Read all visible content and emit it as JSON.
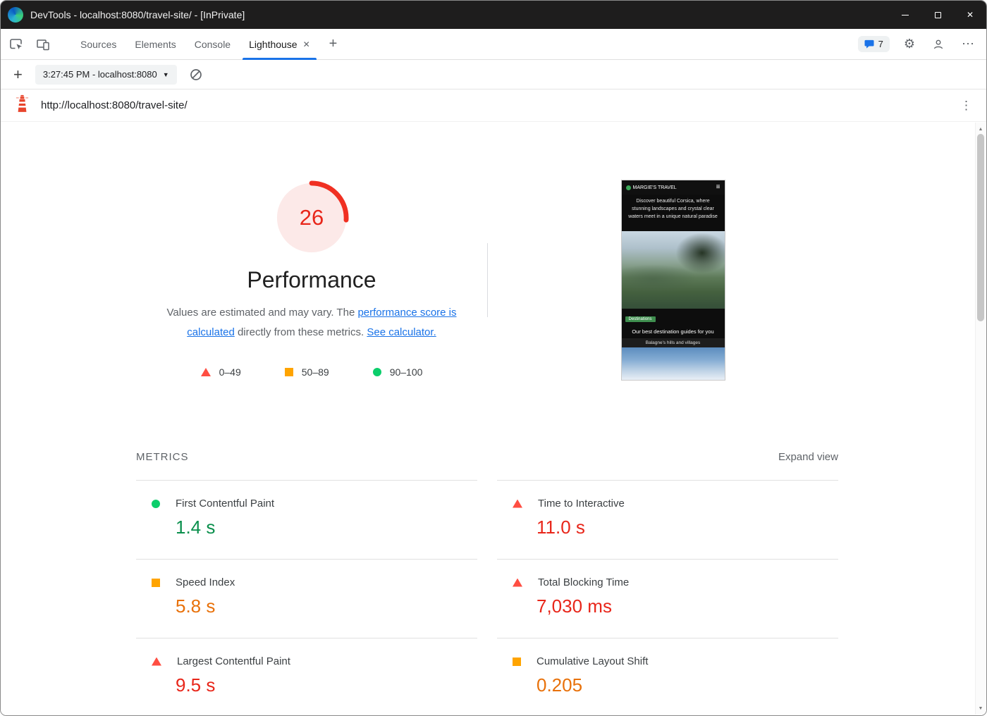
{
  "window": {
    "title": "DevTools - localhost:8080/travel-site/ - [InPrivate]"
  },
  "devtools": {
    "tabs": [
      {
        "label": "Sources"
      },
      {
        "label": "Elements"
      },
      {
        "label": "Console"
      },
      {
        "label": "Lighthouse"
      }
    ],
    "active_tab": "Lighthouse",
    "issues_count": "7"
  },
  "lighthouse_toolbar": {
    "report_selector": "3:27:45 PM - localhost:8080"
  },
  "url_bar": {
    "url": "http://localhost:8080/travel-site/"
  },
  "report": {
    "score": "26",
    "category": "Performance",
    "description": {
      "text_1": "Values are estimated and may vary. The ",
      "link_1": "performance score is calculated",
      "text_2": " directly from these metrics. ",
      "link_2": "See calculator."
    },
    "legend": [
      {
        "label": "0–49",
        "shape": "triangle"
      },
      {
        "label": "50–89",
        "shape": "square"
      },
      {
        "label": "90–100",
        "shape": "circle"
      }
    ],
    "metrics_title": "METRICS",
    "expand_view_label": "Expand view",
    "metrics": [
      {
        "name": "First Contentful Paint",
        "value": "1.4 s",
        "rating": "good"
      },
      {
        "name": "Time to Interactive",
        "value": "11.0 s",
        "rating": "poor"
      },
      {
        "name": "Speed Index",
        "value": "5.8 s",
        "rating": "average"
      },
      {
        "name": "Total Blocking Time",
        "value": "7,030 ms",
        "rating": "poor"
      },
      {
        "name": "Largest Contentful Paint",
        "value": "9.5 s",
        "rating": "poor"
      },
      {
        "name": "Cumulative Layout Shift",
        "value": "0.205",
        "rating": "average"
      }
    ]
  },
  "thumbnail": {
    "site_name": "MARGIE'S TRAVEL",
    "hero_text": "Discover beautiful Corsica, where stunning landscapes and crystal clear waters meet in a unique natural paradise",
    "badge": "Destinations",
    "subtitle": "Our best destination guides for you",
    "caption": "Balagne's hills and villages"
  },
  "colors": {
    "accent": "#1a73e8",
    "good_icon": "#0cce6b",
    "average_icon": "#ffa400",
    "poor_icon": "#ff4e42",
    "good_text": "#0a8f4c",
    "average_text": "#e8710a",
    "poor_text": "#e8261a",
    "score_arc": "#f03022",
    "score_fill": "#fce9e8",
    "score_text": "#e8261a"
  }
}
